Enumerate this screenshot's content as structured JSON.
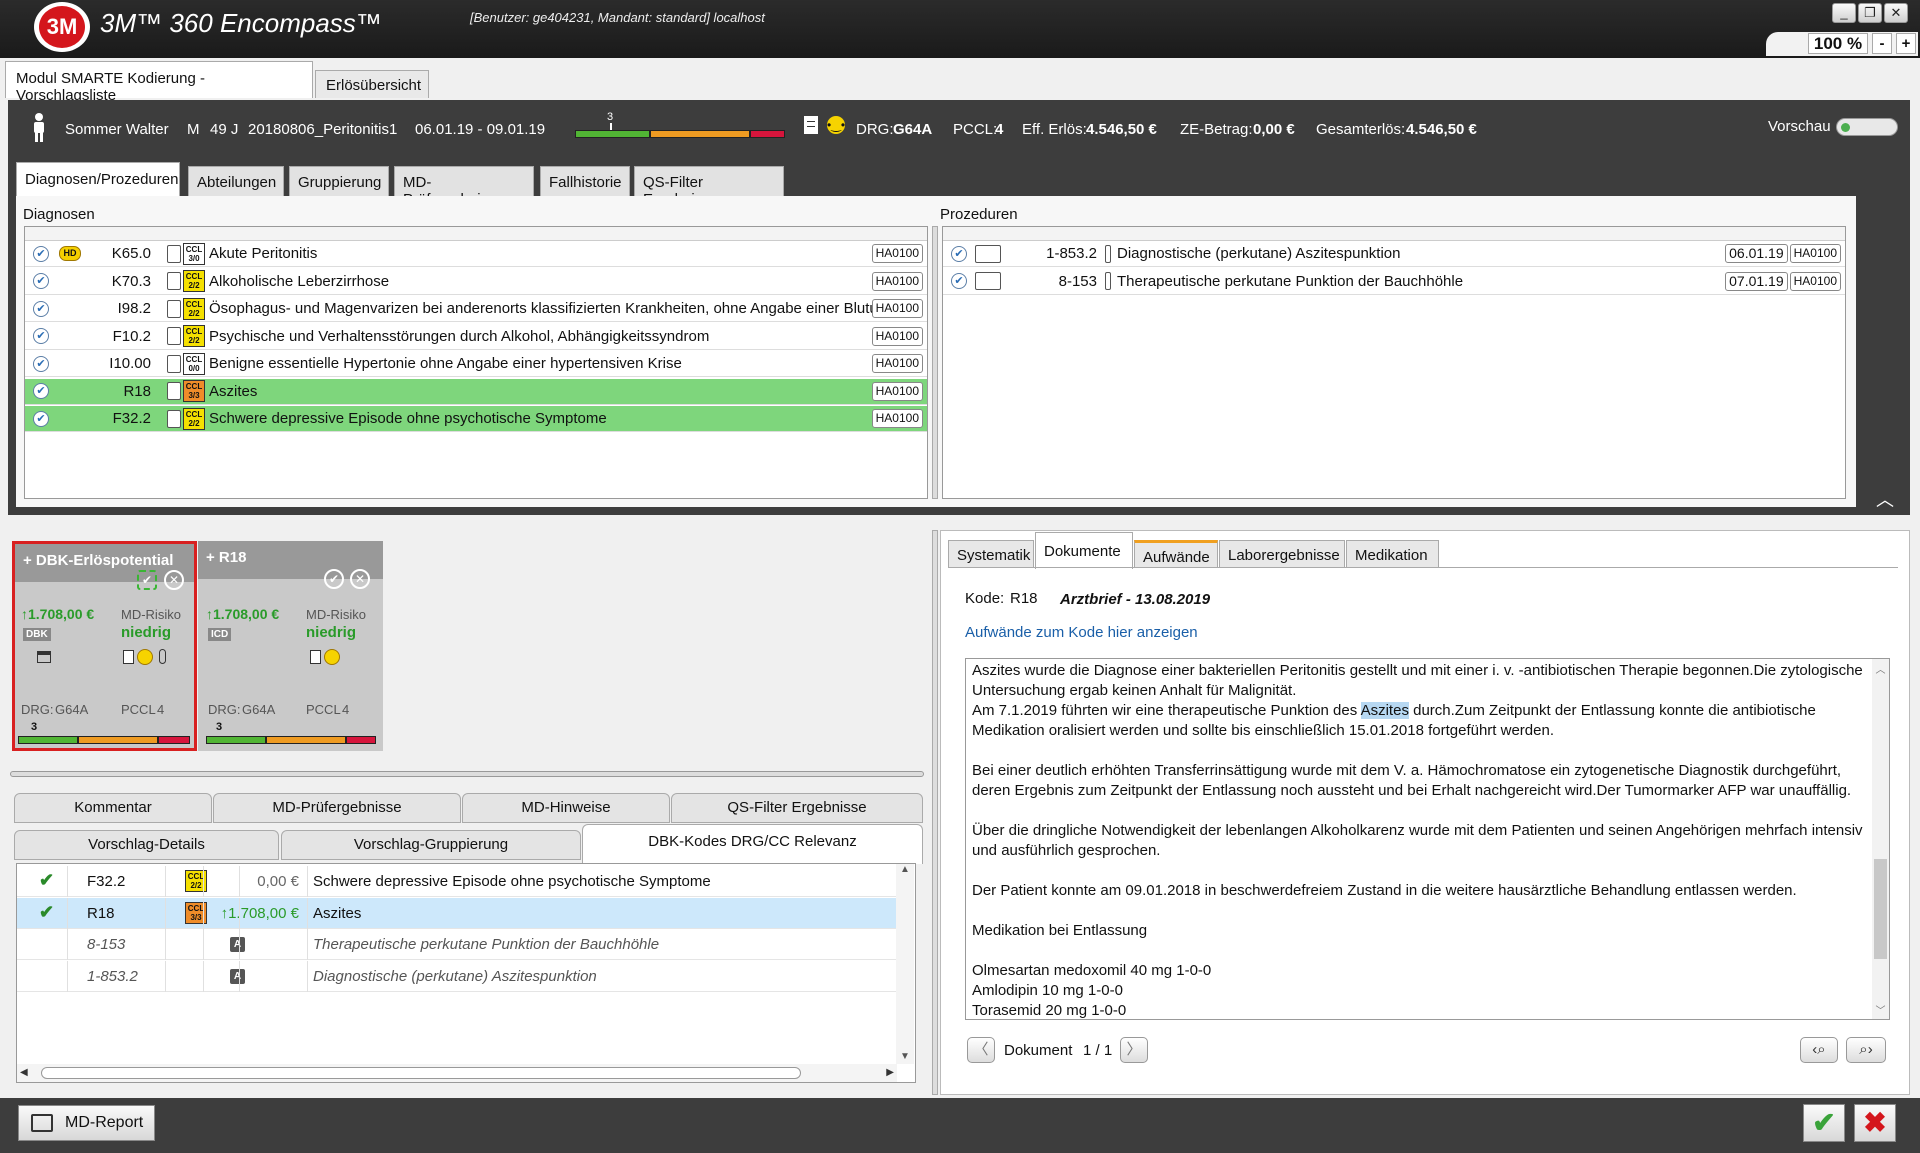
{
  "window": {
    "app_title": "3M™ 360 Encompass™",
    "logo_text": "3M",
    "user_info": "[Benutzer: ge404231, Mandant: standard] localhost",
    "zoom": "100 %",
    "zoom_minus": "-",
    "zoom_plus": "+"
  },
  "top_tabs": [
    "Modul SMARTE Kodierung - Vorschlagsliste",
    "Erlösübersicht"
  ],
  "patient": {
    "name": "Sommer Walter",
    "sex": "M",
    "age": "49 J",
    "case": "20180806_Peritonitis1",
    "dates": "06.01.19 - 09.01.19",
    "scale_marker": "3",
    "drg_label": "DRG:",
    "drg": "G64A",
    "pccl_label": "PCCL:",
    "pccl": "4",
    "eff_label": "Eff. Erlös:",
    "eff": "4.546,50 €",
    "ze_label": "ZE-Betrag:",
    "ze": "0,00 €",
    "ges_label": "Gesamterlös:",
    "ges": "4.546,50 €",
    "vorschau": "Vorschau"
  },
  "inner_tabs": [
    "Diagnosen/Prozeduren",
    "Abteilungen",
    "Gruppierung",
    "MD-Prüfergebnisse",
    "Fallhistorie",
    "QS-Filter Ergebnisse"
  ],
  "diagnosen": {
    "title": "Diagnosen",
    "rows": [
      {
        "code": "K65.0",
        "ccl": "CCL 3/0",
        "cclcolor": "white",
        "text": "Akute Peritonitis",
        "badge": "HA0100",
        "hd": "HD",
        "green": false
      },
      {
        "code": "K70.3",
        "ccl": "CCL 2/2",
        "cclcolor": "yellow",
        "text": "Alkoholische Leberzirrhose",
        "badge": "HA0100",
        "green": false
      },
      {
        "code": "I98.2",
        "ccl": "CCL 2/2",
        "cclcolor": "yellow",
        "text": "Ösophagus- und Magenvarizen bei anderenorts klassifizierten Krankheiten, ohne Angabe einer Blutung",
        "badge": "HA0100",
        "green": false
      },
      {
        "code": "F10.2",
        "ccl": "CCL 2/2",
        "cclcolor": "yellow",
        "text": "Psychische und Verhaltensstörungen durch Alkohol, Abhängigkeitssyndrom",
        "badge": "HA0100",
        "green": false
      },
      {
        "code": "I10.00",
        "ccl": "CCL 0/0",
        "cclcolor": "white",
        "text": "Benigne essentielle Hypertonie ohne Angabe einer hypertensiven Krise",
        "badge": "HA0100",
        "green": false
      },
      {
        "code": "R18",
        "ccl": "CCL 3/3",
        "cclcolor": "orange",
        "text": "Aszites",
        "badge": "HA0100",
        "green": true
      },
      {
        "code": "F32.2",
        "ccl": "CCL 2/2",
        "cclcolor": "yellow",
        "text": "Schwere depressive Episode ohne psychotische Symptome",
        "badge": "HA0100",
        "green": true
      }
    ]
  },
  "prozeduren": {
    "title": "Prozeduren",
    "rows": [
      {
        "code": "1-853.2",
        "text": "Diagnostische (perkutane) Aszitespunktion",
        "date": "06.01.19",
        "badge": "HA0100"
      },
      {
        "code": "8-153",
        "text": "Therapeutische perkutane Punktion der Bauchhöhle",
        "date": "07.01.19",
        "badge": "HA0100"
      }
    ]
  },
  "cards": [
    {
      "title": "+ DBK-Erlöspotential",
      "gain": "↑1.708,00 €",
      "risk_label": "MD-Risiko",
      "risk": "niedrig",
      "tag": "DBK",
      "drg_label": "DRG:",
      "drg": "G64A",
      "pccl_label": "PCCL",
      "pccl": "4",
      "scale": "3"
    },
    {
      "title": "+ R18",
      "gain": "↑1.708,00 €",
      "risk_label": "MD-Risiko",
      "risk": "niedrig",
      "tag": "ICD",
      "drg_label": "DRG:",
      "drg": "G64A",
      "pccl_label": "PCCL",
      "pccl": "4",
      "scale": "3"
    }
  ],
  "lower_tabs_row1": [
    "Kommentar",
    "MD-Prüfergebnisse",
    "MD-Hinweise",
    "QS-Filter Ergebnisse"
  ],
  "lower_tabs_row2": [
    "Vorschlag-Details",
    "Vorschlag-Gruppierung",
    "DBK-Kodes DRG/CC Relevanz"
  ],
  "dbk_rows": [
    {
      "check": "✔",
      "code": "F32.2",
      "ccl": "CCL 2/2",
      "cclcolor": "yellow",
      "amount": "0,00 €",
      "text": "Schwere depressive Episode ohne psychotische Symptome"
    },
    {
      "check": "✔",
      "code": "R18",
      "ccl": "CCL 3/3",
      "cclcolor": "orange",
      "amount": "↑1.708,00 €",
      "text": "Aszites"
    },
    {
      "check": "",
      "code": "8-153",
      "abadge": "A",
      "text": "Therapeutische perkutane Punktion der Bauchhöhle"
    },
    {
      "check": "",
      "code": "1-853.2",
      "abadge": "A",
      "text": "Diagnostische (perkutane) Aszitespunktion"
    }
  ],
  "right_tabs": [
    "Systematik",
    "Dokumente",
    "Aufwände",
    "Laborergebnisse",
    "Medikation"
  ],
  "document": {
    "kode_label": "Kode:",
    "kode": "R18",
    "title": "Arztbrief - 13.08.2019",
    "link": "Aufwände zum Kode hier anzeigen",
    "p1a": "Aszites wurde die Diagnose einer bakteriellen Peritonitis gestellt und mit einer i. v. -antibiotischen Therapie begonnen.Die zytologische Untersuchung ergab keinen Anhalt für Malignität.",
    "p1b_pre": "Am 7.1.2019 führten wir eine therapeutische Punktion des ",
    "p1b_hl": "Aszites",
    "p1b_post": " durch.Zum Zeitpunkt der Entlassung konnte die antibiotische Medikation oralisiert werden und sollte bis einschließlich 15.01.2018 fortgeführt werden.",
    "p2": "Bei einer deutlich erhöhten Transferrinsättigung wurde mit dem V. a. Hämochromatose ein zytogenetische Diagnostik durchgeführt, deren Ergebnis zum Zeitpunkt der Entlassung noch aussteht und bei Erhalt nachgereicht wird.Der Tumormarker AFP war unauffällig.",
    "p3": "Über die dringliche Notwendigkeit der lebenlangen Alkoholkarenz wurde mit dem Patienten und seinen Angehörigen mehrfach intensiv und ausführlich gesprochen.",
    "p4": "Der Patient konnte am 09.01.2018 in beschwerdefreiem Zustand in die weitere hausärztliche Behandlung entlassen werden.",
    "p5": "Medikation bei Entlassung",
    "med1": "Olmesartan medoxomil 40 mg 1-0-0",
    "med2": "Amlodipin 10 mg 1-0-0",
    "med3": "Torasemid 20 mg 1-0-0",
    "nav_label": "Dokument",
    "nav_page": "1 / 1"
  },
  "bottom": {
    "md_report": "MD-Report",
    "ok": "✔",
    "cancel": "✖"
  },
  "colors": {
    "dark": "#3d3d3d",
    "green_row": "#7ed67c",
    "accent_green": "#2a9b2a",
    "cancel_red": "#d4161c"
  }
}
